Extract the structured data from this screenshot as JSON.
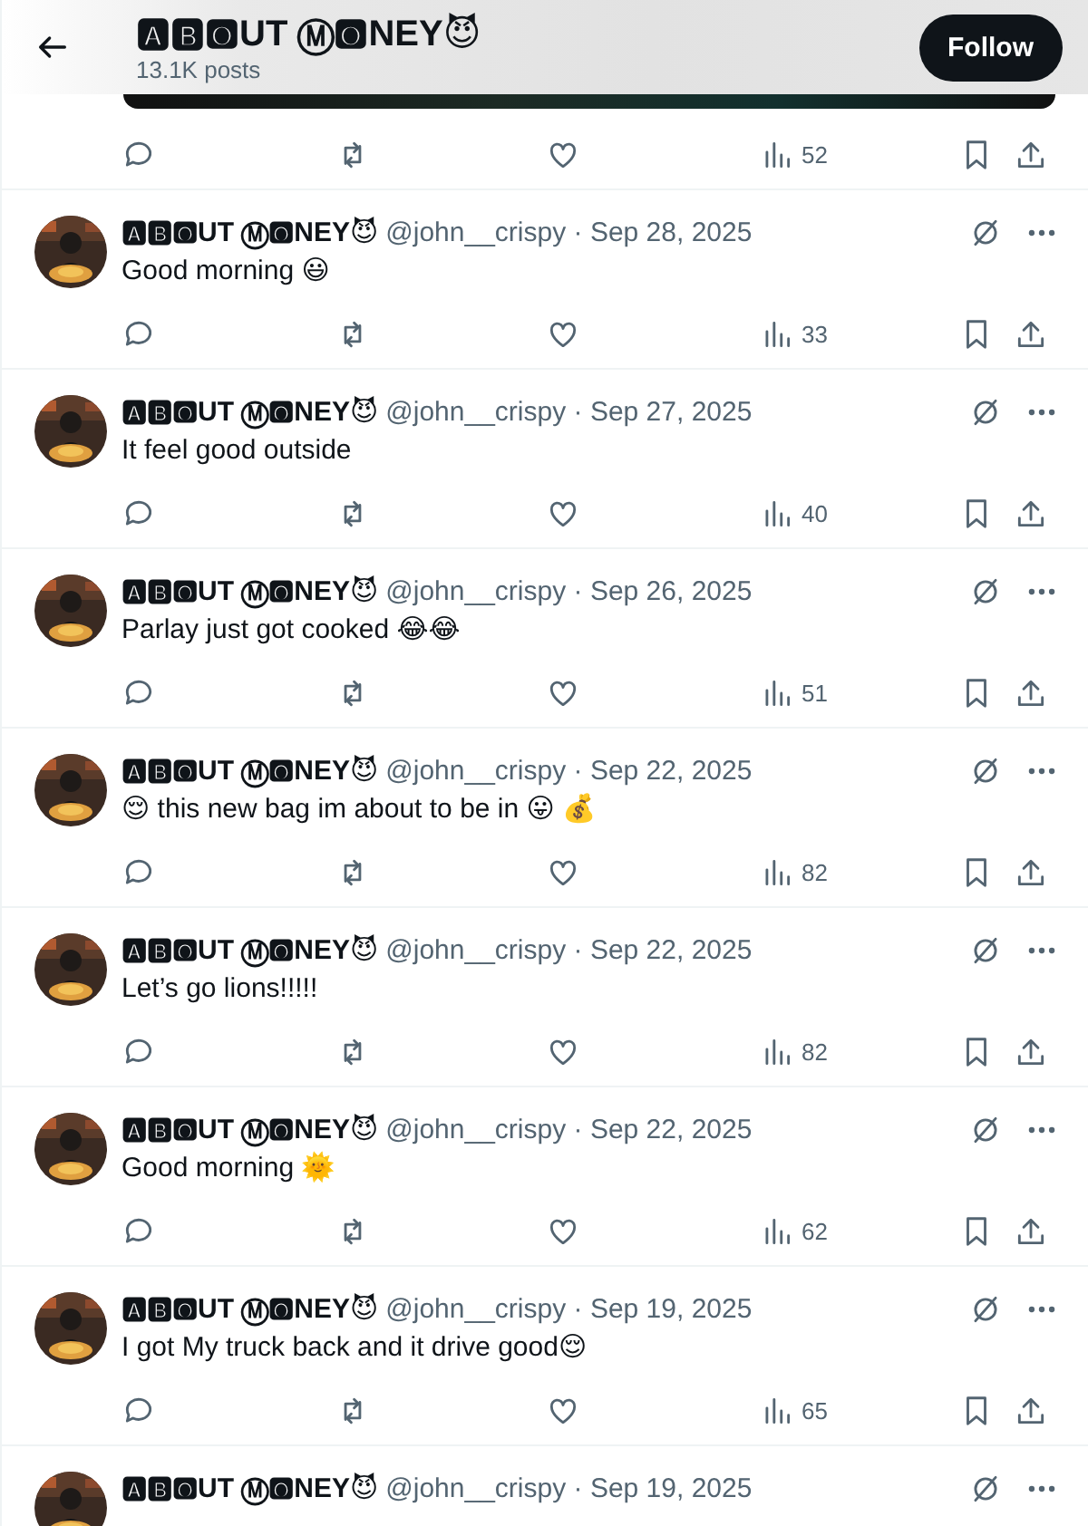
{
  "header": {
    "title": "🅰🅱🅾UT Ⓜ🅾NEY😈",
    "posts_count": "13.1K posts",
    "follow_button": "Follow"
  },
  "top_post": {
    "views": "52"
  },
  "posts": [
    {
      "name": "🅰🅱🅾UT Ⓜ🅾NEY😈",
      "handle": "@john__crispy",
      "separator": "·",
      "date": "Sep 28, 2025",
      "text": "Good morning 😃",
      "views": "33"
    },
    {
      "name": "🅰🅱🅾UT Ⓜ🅾NEY😈",
      "handle": "@john__crispy",
      "separator": "·",
      "date": "Sep 27, 2025",
      "text": "It feel good outside",
      "views": "40"
    },
    {
      "name": "🅰🅱🅾UT Ⓜ🅾NEY😈",
      "handle": "@john__crispy",
      "separator": "·",
      "date": "Sep 26, 2025",
      "text": "Parlay just got cooked 😂😂",
      "views": "51"
    },
    {
      "name": "🅰🅱🅾UT Ⓜ🅾NEY😈",
      "handle": "@john__crispy",
      "separator": "·",
      "date": "Sep 22, 2025",
      "text": "😌 this new bag im about to be in 😛 💰",
      "views": "82"
    },
    {
      "name": "🅰🅱🅾UT Ⓜ🅾NEY😈",
      "handle": "@john__crispy",
      "separator": "·",
      "date": "Sep 22, 2025",
      "text": "Let’s go lions!!!!!",
      "views": "82"
    },
    {
      "name": "🅰🅱🅾UT Ⓜ🅾NEY😈",
      "handle": "@john__crispy",
      "separator": "·",
      "date": "Sep 22, 2025",
      "text": "Good morning 🌞",
      "views": "62"
    },
    {
      "name": "🅰🅱🅾UT Ⓜ🅾NEY😈",
      "handle": "@john__crispy",
      "separator": "·",
      "date": "Sep 19, 2025",
      "text": "I got My truck back and it drive good😌",
      "views": "65"
    },
    {
      "name": "🅰🅱🅾UT Ⓜ🅾NEY😈",
      "handle": "@john__crispy",
      "separator": "·",
      "date": "Sep 19, 2025"
    }
  ]
}
